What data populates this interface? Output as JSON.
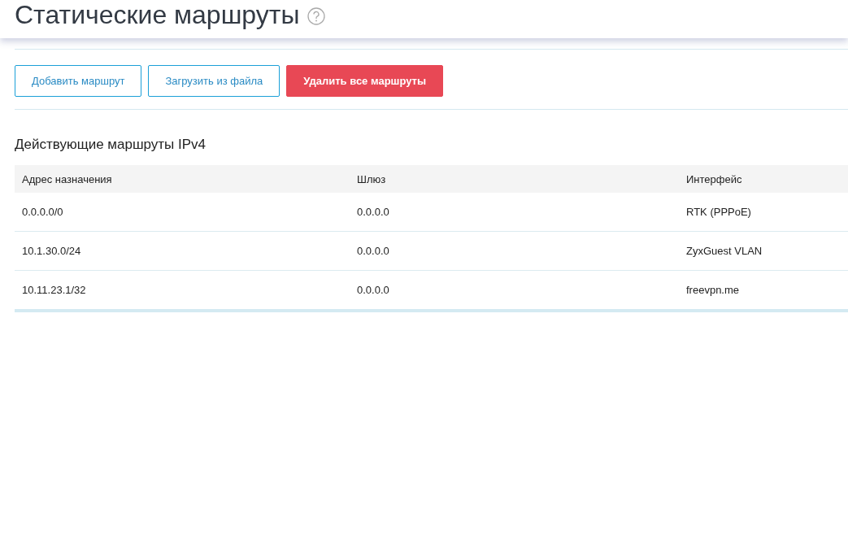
{
  "page": {
    "title": "Статические маршруты"
  },
  "buttons": [
    {
      "label": "Добавить маршрут",
      "kind": "outline"
    },
    {
      "label": "Загрузить из файла",
      "kind": "outline"
    },
    {
      "label": "Удалить все маршруты",
      "kind": "danger"
    }
  ],
  "section": {
    "title": "Действующие маршруты IPv4"
  },
  "table": {
    "columns": [
      "Адрес назначения",
      "Шлюз",
      "Интерфейс"
    ],
    "rows": [
      [
        "0.0.0.0/0",
        "0.0.0.0",
        "RTK (PPPoE)"
      ],
      [
        "10.1.30.0/24",
        "0.0.0.0",
        "ZyxGuest VLAN"
      ],
      [
        "10.11.23.1/32",
        "0.0.0.0",
        "freevpn.me"
      ]
    ]
  }
}
